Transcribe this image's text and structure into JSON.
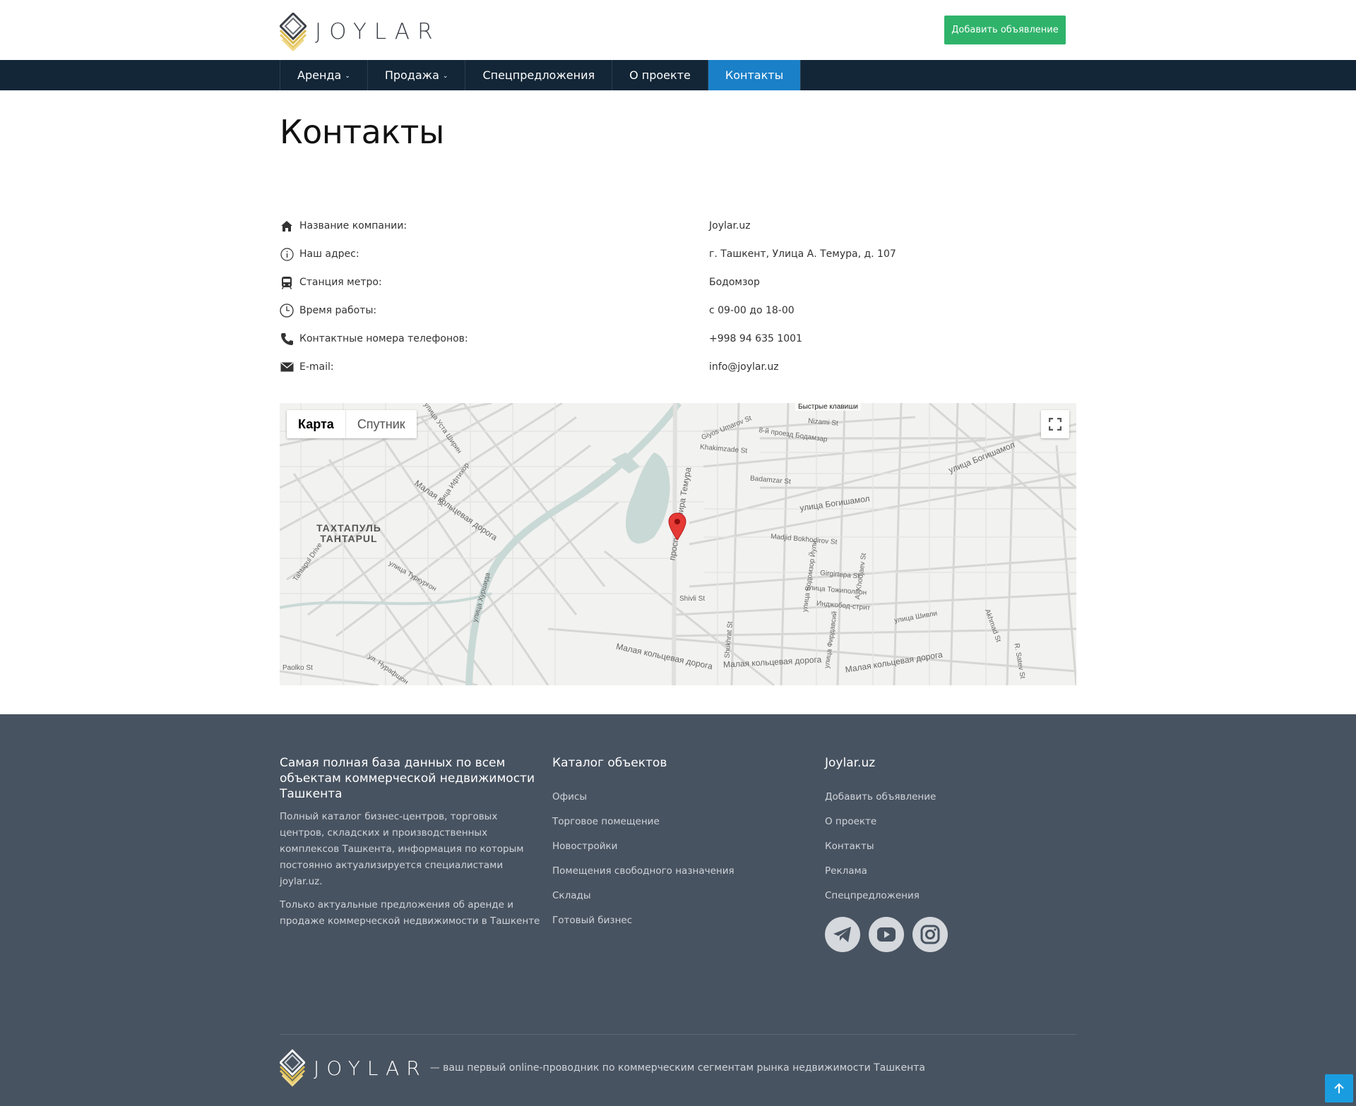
{
  "header": {
    "logo_text": "JOYLAR",
    "add_button": "Добавить объявление"
  },
  "nav": {
    "items": [
      {
        "label": "Аренда",
        "dropdown": true
      },
      {
        "label": "Продажа",
        "dropdown": true
      },
      {
        "label": "Спецпредложения"
      },
      {
        "label": "О проекте"
      },
      {
        "label": "Контакты",
        "active": true
      }
    ]
  },
  "page": {
    "title": "Контакты"
  },
  "contacts": [
    {
      "icon": "home-icon",
      "label": "Название компании:",
      "value": "Joylar.uz"
    },
    {
      "icon": "info-icon",
      "label": "Наш адрес:",
      "value": "г. Ташкент, Улица А. Темура, д. 107"
    },
    {
      "icon": "metro-icon",
      "label": "Станция метро:",
      "value": "Бодомзор"
    },
    {
      "icon": "clock-icon",
      "label": "Время работы:",
      "value": "с 09-00 до 18-00"
    },
    {
      "icon": "phone-icon",
      "label": "Контактные номера телефонов:",
      "value": "+998 94 635 1001"
    },
    {
      "icon": "mail-icon",
      "label": "E-mail:",
      "value": "info@joylar.uz"
    }
  ],
  "map": {
    "tab_map": "Карта",
    "tab_satellite": "Спутник",
    "shortcuts": "Быстрые клавиши",
    "district_line1": "ТАХТАПУЛЬ",
    "district_line2": "TAHTAPUL",
    "streets": {
      "s1": "Малая кольцевая дорога",
      "s2": "Малая кольцевая дорога",
      "s3": "Малая кольцевая дорога",
      "s4": "Малая кольцевая дорога",
      "s5": "улица Богишамол",
      "s6": "улица Богишамол",
      "s7": "Madjid Bokhodirov St",
      "s8": "Girgirtepa St",
      "s9": "улица Тожиполвон",
      "s10": "Инджобод-стрит",
      "s11": "Shivli St",
      "s12": "улица Шивли",
      "s13": "Badamzar St",
      "s14": "Khakimzade St",
      "s15": "Nizami St",
      "s16": "8-й проезд Бодамзар",
      "s17": "Giyos Umarov St",
      "s18": "проспект Амира Темура",
      "s19": "улица Хуршида",
      "s20": "улица Туркурғон",
      "s21": "Paolko St",
      "s22": "ул. Нурафшон",
      "s23": "Shukhrat St",
      "s24": "улица Бодомзор Йули",
      "s25": "A. Khodjaev St",
      "s26": "улица Фирдавсий",
      "s27": "Akhmad St",
      "s28": "R. Satev St",
      "s29": "улица Ифтихор",
      "s30": "Tahtapul Drive",
      "s31": "улица Устa Ширин"
    }
  },
  "footer": {
    "col1_title": "Самая полная база данных по всем объектам коммерческой недвижимости Ташкента",
    "col1_p1": "Полный каталог бизнес-центров, торговых центров, складских и производственных комплексов Ташкента, информация по которым постоянно актуализируется специалистами joylar.uz.",
    "col1_p2": "Только актуальные предложения об аренде и продаже коммерческой недвижимости в Ташкенте",
    "col2_title": "Каталог объектов",
    "col2_links": [
      "Офисы",
      "Торговое помещение",
      "Новостройки",
      "Помещения свободного назначения",
      "Склады",
      "Готовый бизнес"
    ],
    "col3_title": "Joylar.uz",
    "col3_links": [
      "Добавить объявление",
      "О проекте",
      "Контакты",
      "Реклама",
      "Спецпредложения"
    ],
    "social": [
      "telegram-icon",
      "youtube-icon",
      "instagram-icon"
    ],
    "logo_text": "JOYLAR",
    "slogan": "— ваш первый online-проводник по коммерческим сегментам рынка недвижимости Ташкента"
  }
}
